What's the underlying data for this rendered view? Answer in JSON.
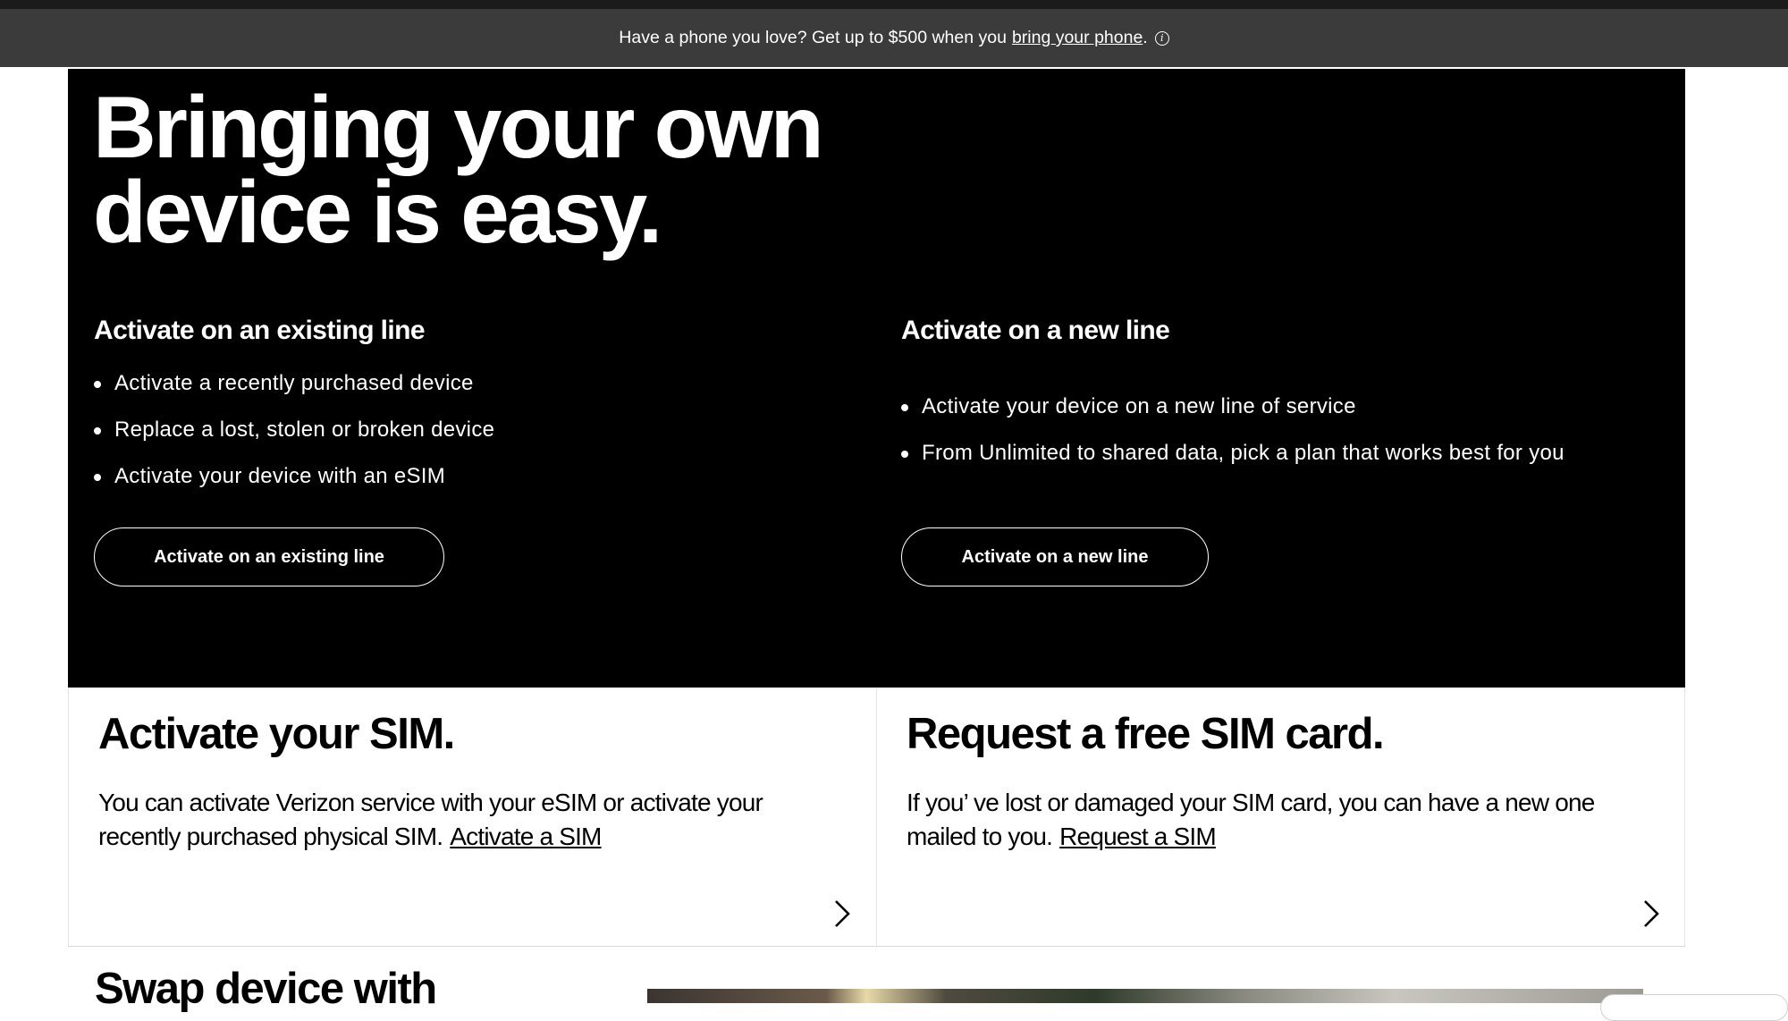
{
  "promo": {
    "text": "Have a phone you love? Get up to $500 when you",
    "link": "bring your phone",
    "suffix": ".",
    "info_icon": "i"
  },
  "hero": {
    "title": "Bringing your own\ndevice is easy.",
    "existing": {
      "heading": "Activate on an existing line",
      "items": [
        "Activate a recently purchased device",
        "Replace a lost, stolen or broken device",
        "Activate your device with an eSIM"
      ],
      "button": "Activate on an existing line"
    },
    "new_line": {
      "heading": "Activate on a new line",
      "items": [
        "Activate your device on a new line of service",
        "From Unlimited to shared data, pick a plan that works best for you"
      ],
      "button": "Activate on a new line"
    }
  },
  "cards": {
    "activate_sim": {
      "title": "Activate your SIM.",
      "body": "You can activate Verizon service with your eSIM or activate your recently purchased physical SIM.",
      "link": "Activate a SIM"
    },
    "request_sim": {
      "title": "Request a free SIM card.",
      "body": "If you’ ve lost or damaged your SIM card, you can have a new one mailed to you.",
      "link": "Request a SIM"
    }
  },
  "bottom": {
    "title": "Swap device with"
  },
  "icons": {
    "chevron": "chevron-right-icon",
    "info": "info-icon"
  },
  "colors": {
    "promo_bg": "#3b3b3b",
    "hero_bg": "#000000",
    "text_dark": "#000000"
  }
}
